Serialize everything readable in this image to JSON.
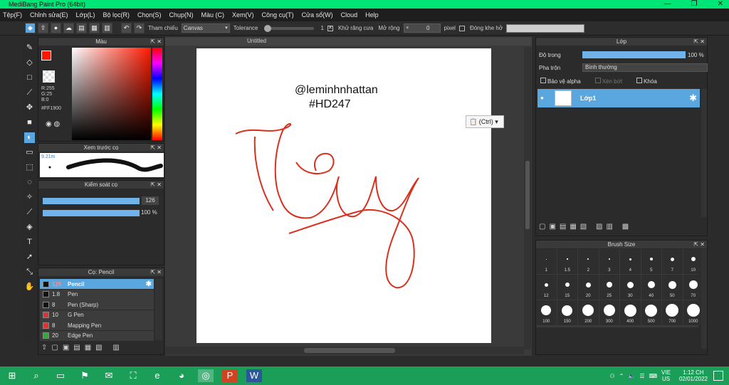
{
  "window": {
    "title": "MediBang Paint Pro (64bit)",
    "min": "—",
    "max": "❐",
    "close": "✕"
  },
  "menu": [
    "Tệp(F)",
    "Chỉnh sửa(E)",
    "Lớp(L)",
    "Bộ lọc(R)",
    "Chọn(S)",
    "Chụp(N)",
    "Màu (C)",
    "Xem(V)",
    "Công cụ(T)",
    "Cửa sổ(W)",
    "Cloud",
    "Help"
  ],
  "toolbar": {
    "ref_label": "Tham chiếu",
    "ref_value": "Canvas",
    "tolerance_label": "Tolerance",
    "tolerance_value": "1",
    "antialias_label": "Khử răng cưa",
    "antialias_check": "✕",
    "expand_label": "Mở rộng",
    "expand_value": "0",
    "expand_unit": "pixel",
    "gap_label": "Đóng khe hở"
  },
  "color_panel": {
    "title": "Màu",
    "r": "R:255",
    "g": "G:25",
    "b": "B:0",
    "hex": "#FF1900",
    "primary": "#ff1900"
  },
  "brush_preview": {
    "title": "Xem trước cọ",
    "size": "9.21m"
  },
  "brush_control": {
    "title": "Kiểm soát cọ",
    "size": "126",
    "opacity": "100 %"
  },
  "brush_list": {
    "title": "Cọ: Pencil",
    "items": [
      {
        "size": "126",
        "name": "Pencil",
        "color": "#111",
        "active": true
      },
      {
        "size": "1.8",
        "name": "Pen",
        "color": "#111"
      },
      {
        "size": "8",
        "name": "Pen (Sharp)",
        "color": "#111"
      },
      {
        "size": "10",
        "name": "G Pen",
        "color": "#d33"
      },
      {
        "size": "8",
        "name": "Mapping Pen",
        "color": "#d33"
      },
      {
        "size": "20",
        "name": "Edge Pen",
        "color": "#3a3"
      }
    ]
  },
  "canvas": {
    "tab": "Untitled",
    "text1": "@leminhnhattan",
    "text2": "#HD247",
    "stroke_color": "#d9301e"
  },
  "paste_popup": "(Ctrl)",
  "layer_panel": {
    "title": "Lớp",
    "opacity_label": "Độ trong",
    "opacity_value": "100 %",
    "blend_label": "Pha trộn",
    "blend_value": "Bình thường",
    "protect_alpha": "Bảo vệ alpha",
    "clip": "Xén bớt",
    "lock": "Khóa",
    "layer_name": "Lớp1"
  },
  "brush_size": {
    "title": "Brush Size",
    "sizes": [
      "1",
      "1.5",
      "2",
      "3",
      "4",
      "5",
      "7",
      "10",
      "12",
      "15",
      "20",
      "25",
      "30",
      "40",
      "50",
      "70",
      "100",
      "150",
      "200",
      "300",
      "400",
      "500",
      "700",
      "1000"
    ]
  },
  "tray": {
    "lang_top": "VIE",
    "lang_bottom": "US",
    "time": "1:12 CH",
    "date": "02/01/2022"
  }
}
